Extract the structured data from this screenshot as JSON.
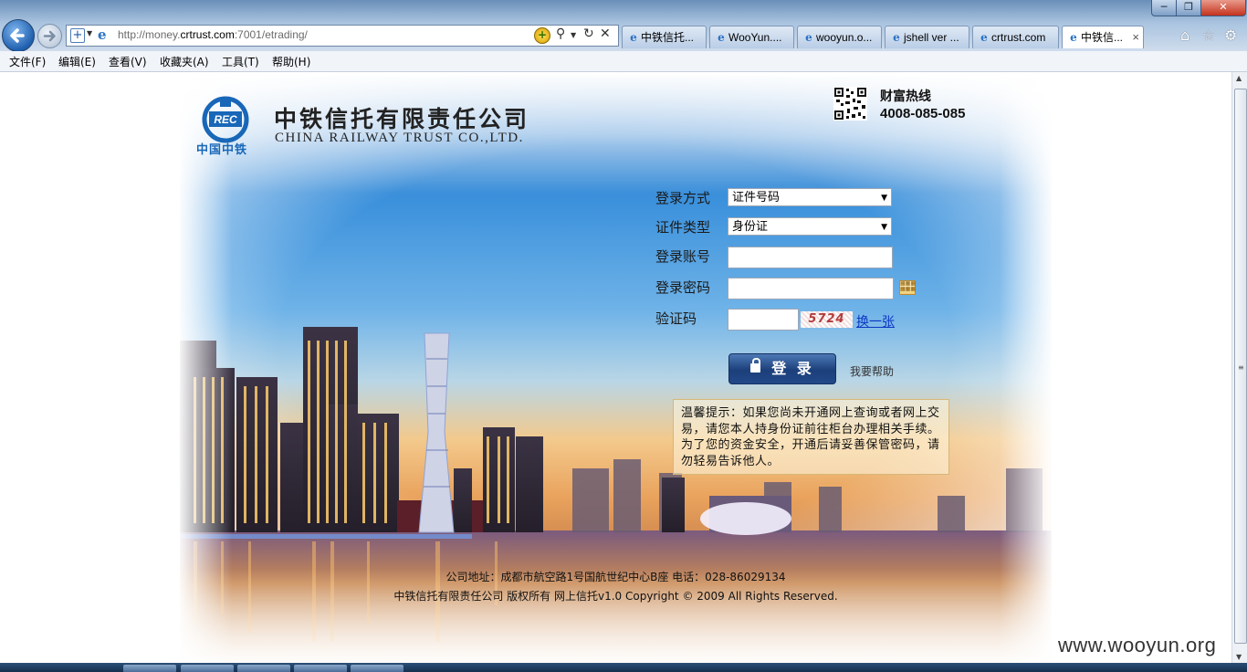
{
  "browser": {
    "url_prefix": "http://money.",
    "url_domain": "crtrust.com",
    "url_suffix": ":7001/etrading/",
    "tabs": [
      {
        "label": "中铁信托..."
      },
      {
        "label": "WooYun...."
      },
      {
        "label": "wooyun.o..."
      },
      {
        "label": "jshell ver ..."
      },
      {
        "label": "crtrust.com"
      },
      {
        "label": "中铁信..."
      }
    ],
    "active_tab_close": "×",
    "menu": [
      "文件(F)",
      "编辑(E)",
      "查看(V)",
      "收藏夹(A)",
      "工具(T)",
      "帮助(H)"
    ],
    "window_buttons": {
      "minimize": "─",
      "maximize": "❐",
      "close": "✕"
    }
  },
  "logo": {
    "name_cn": "中铁信托有限责任公司",
    "name_en": "CHINA RAILWAY TRUST CO.,LTD.",
    "badge_text": "REC",
    "sub_text": "中国中铁",
    "color": "#1867b8"
  },
  "hotline": {
    "label": "财富热线",
    "number": "4008-085-085"
  },
  "form": {
    "login_method_label": "登录方式",
    "login_method_value": "证件号码",
    "id_type_label": "证件类型",
    "id_type_value": "身份证",
    "account_label": "登录账号",
    "account_value": "",
    "password_label": "登录密码",
    "password_value": "",
    "captcha_label": "验证码",
    "captcha_value": "",
    "captcha_image_text": "5724",
    "captcha_refresh": "换一张",
    "login_button": "登 录",
    "help_link": "我要帮助"
  },
  "notice": "温馨提示：如果您尚未开通网上查询或者网上交易，请您本人持身份证前往柜台办理相关手续。为了您的资金安全，开通后请妥善保管密码，请勿轻易告诉他人。",
  "footer": {
    "address": "公司地址：成都市航空路1号国航世纪中心B座  电话：028-86029134",
    "copyright": "中铁信托有限责任公司 版权所有  网上信托v1.0  Copyright © 2009 All Rights Reserved."
  },
  "watermark": "www.wooyun.org",
  "colors": {
    "login_button": "#1c3f7a",
    "link": "#0b36c4"
  }
}
